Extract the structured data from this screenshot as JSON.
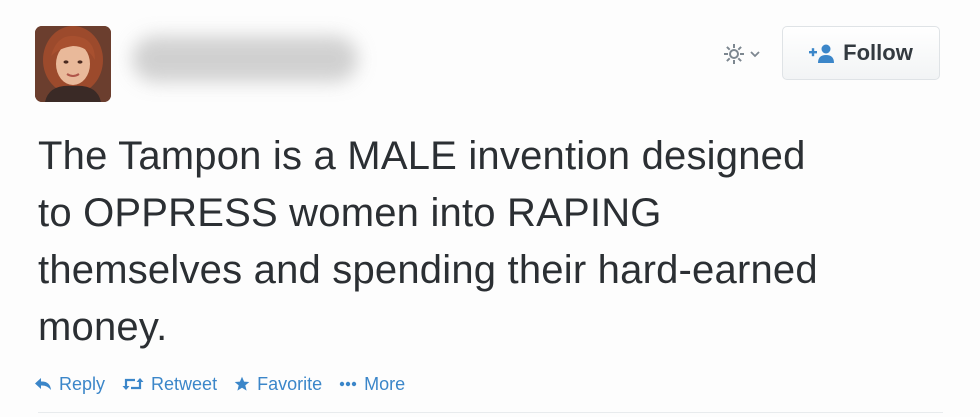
{
  "tweet": {
    "text_lines": [
      "The Tampon is a MALE invention designed",
      "to OPPRESS women into RAPING",
      "themselves and spending their hard-earned",
      "money."
    ],
    "author_name": ""
  },
  "header": {
    "follow_label": "Follow",
    "gear_icon": "gear-icon",
    "follow_icon": "add-user-icon"
  },
  "actions": {
    "reply": "Reply",
    "retweet": "Retweet",
    "favorite": "Favorite",
    "more": "More"
  },
  "colors": {
    "action_blue": "#3b86c9",
    "text": "#2b2f33",
    "background": "#fdfdfd"
  }
}
